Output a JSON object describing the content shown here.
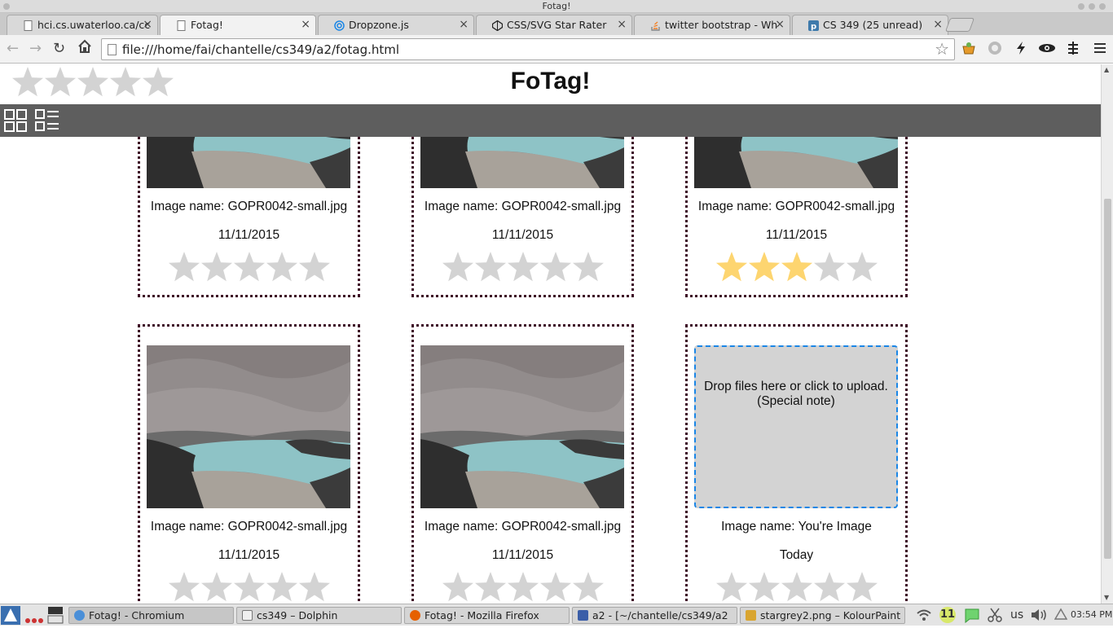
{
  "window": {
    "title": "Fotag!"
  },
  "tabs": [
    {
      "label": "hci.cs.uwaterloo.ca/cc",
      "icon": "page-icon",
      "active": false
    },
    {
      "label": "Fotag!",
      "icon": "page-icon",
      "active": true
    },
    {
      "label": "Dropzone.js",
      "icon": "dropzone-icon",
      "active": false
    },
    {
      "label": "CSS/SVG Star Rater",
      "icon": "codepen-icon",
      "active": false
    },
    {
      "label": "twitter bootstrap - Wh",
      "icon": "stackoverflow-icon",
      "active": false
    },
    {
      "label": "CS 349 (25 unread)",
      "icon": "piazza-icon",
      "active": false
    }
  ],
  "toolbar": {
    "url": "file:///home/fai/chantelle/cs349/a2/fotag.html"
  },
  "page": {
    "title": "FoTag!",
    "filter_rating": 0
  },
  "cards": [
    {
      "name": "Image name: GOPR0042-small.jpg",
      "date": "11/11/2015",
      "rating": 0
    },
    {
      "name": "Image name: GOPR0042-small.jpg",
      "date": "11/11/2015",
      "rating": 0
    },
    {
      "name": "Image name: GOPR0042-small.jpg",
      "date": "11/11/2015",
      "rating": 3
    },
    {
      "name": "Image name: GOPR0042-small.jpg",
      "date": "11/11/2015",
      "rating": 0
    },
    {
      "name": "Image name: GOPR0042-small.jpg",
      "date": "11/11/2015",
      "rating": 0
    },
    {
      "name": "Image name: You're Image",
      "date": "Today",
      "rating": 0
    }
  ],
  "dropzone": {
    "line1": "Drop files here or click to upload.",
    "line2": "(Special note)"
  },
  "colors": {
    "star_off": "#d3d3d3",
    "star_on": "#fdd570",
    "card_border": "#3d0a24",
    "viewbar": "#5e5e5e",
    "dropzone_border": "#1a86e6"
  },
  "taskbar": {
    "tasks": [
      {
        "label": "Fotag! - Chromium",
        "active": true
      },
      {
        "label": "cs349 – Dolphin",
        "active": false
      },
      {
        "label": "Fotag! - Mozilla Firefox",
        "active": false
      },
      {
        "label": "a2 - [~/chantelle/cs349/a2",
        "active": false
      },
      {
        "label": "stargrey2.png – KolourPaint",
        "active": false
      }
    ],
    "badge": "11",
    "keyboard": "us",
    "clock": "03:54 PM"
  }
}
